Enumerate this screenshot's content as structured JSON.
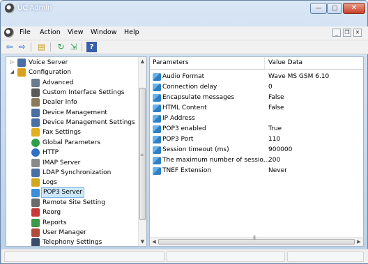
{
  "window": {
    "title": "UC Admin"
  },
  "title_buttons": {
    "minimize": "—",
    "maximize": "□",
    "close": "✕"
  },
  "menubar": {
    "items": [
      "File",
      "Action",
      "View",
      "Window",
      "Help"
    ],
    "mdi": {
      "minimize": "_",
      "restore": "❐",
      "close": "✕"
    }
  },
  "toolbar": {
    "buttons": [
      {
        "icon": "back-arrow-icon",
        "glyph": "⇦"
      },
      {
        "icon": "forward-arrow-icon",
        "glyph": "⇨"
      },
      {
        "icon": "up-folder-icon",
        "glyph": "▤"
      },
      {
        "icon": "refresh-icon",
        "glyph": "↻"
      },
      {
        "icon": "export-icon",
        "glyph": "⇲"
      },
      {
        "icon": "help-icon",
        "glyph": "?"
      }
    ]
  },
  "tree": {
    "items": [
      {
        "label": "Voice Server",
        "icon": "server-icon",
        "color": "#4a6fa5",
        "expander": "▷",
        "level": 0
      },
      {
        "label": "Configuration",
        "icon": "config-icon",
        "color": "#d9a21b",
        "expander": "◢",
        "level": 0
      },
      {
        "label": "Advanced",
        "icon": "advanced-icon",
        "color": "#6b7c8f",
        "level": 1
      },
      {
        "label": "Custom Interface Settings",
        "icon": "custom-interface-icon",
        "color": "#5a5a5a",
        "level": 1
      },
      {
        "label": "Dealer Info",
        "icon": "dealer-info-icon",
        "color": "#8a7a5a",
        "level": 1
      },
      {
        "label": "Device Management",
        "icon": "device-management-icon",
        "color": "#4a6fa5",
        "level": 1
      },
      {
        "label": "Device Management Settings",
        "icon": "device-settings-icon",
        "color": "#4a6fa5",
        "level": 1
      },
      {
        "label": "Fax Settings",
        "icon": "fax-icon",
        "color": "#e0b020",
        "level": 1
      },
      {
        "label": "Global Parameters",
        "icon": "globe-icon",
        "color": "#2e9e48",
        "level": 1
      },
      {
        "label": "HTTP",
        "icon": "http-icon",
        "color": "#2f6fc4",
        "level": 1
      },
      {
        "label": "IMAP Server",
        "icon": "imap-icon",
        "color": "#8a8a8a",
        "level": 1
      },
      {
        "label": "LDAP Synchronization",
        "icon": "ldap-icon",
        "color": "#4a6fa5",
        "level": 1
      },
      {
        "label": "Logs",
        "icon": "logs-icon",
        "color": "#d0a820",
        "level": 1
      },
      {
        "label": "POP3 Server",
        "icon": "pop3-icon",
        "color": "#3a8fd8",
        "level": 1,
        "selected": true
      },
      {
        "label": "Remote Site Setting",
        "icon": "remote-site-icon",
        "color": "#6a6a6a",
        "level": 1
      },
      {
        "label": "Reorg",
        "icon": "reorg-icon",
        "color": "#c83a3a",
        "level": 1
      },
      {
        "label": "Reports",
        "icon": "reports-icon",
        "color": "#3a9a4a",
        "level": 1
      },
      {
        "label": "User Manager",
        "icon": "user-manager-icon",
        "color": "#b04a3a",
        "level": 1
      },
      {
        "label": "Telephony Settings",
        "icon": "telephony-icon",
        "color": "#3a4a6a",
        "level": 1
      }
    ]
  },
  "list": {
    "columns": [
      "Parameters",
      "Value Data"
    ],
    "rows": [
      {
        "name": "Audio Format",
        "value": "Wave MS GSM 6.10"
      },
      {
        "name": "Connection delay",
        "value": "0"
      },
      {
        "name": "Encapsulate messages",
        "value": "False"
      },
      {
        "name": "HTML Content",
        "value": "False"
      },
      {
        "name": "IP Address",
        "value": ""
      },
      {
        "name": "POP3 enabled",
        "value": "True"
      },
      {
        "name": "POP3 Port",
        "value": "110"
      },
      {
        "name": "Session timeout (ms)",
        "value": "900000"
      },
      {
        "name": "The maximum number of sessio...",
        "value": "200"
      },
      {
        "name": "TNEF Extension",
        "value": "Never"
      }
    ]
  },
  "scrollbars": {
    "up": "▲",
    "down": "▼",
    "left": "◀",
    "right": "▶",
    "grip_v": "≡",
    "grip_h": "|||"
  }
}
